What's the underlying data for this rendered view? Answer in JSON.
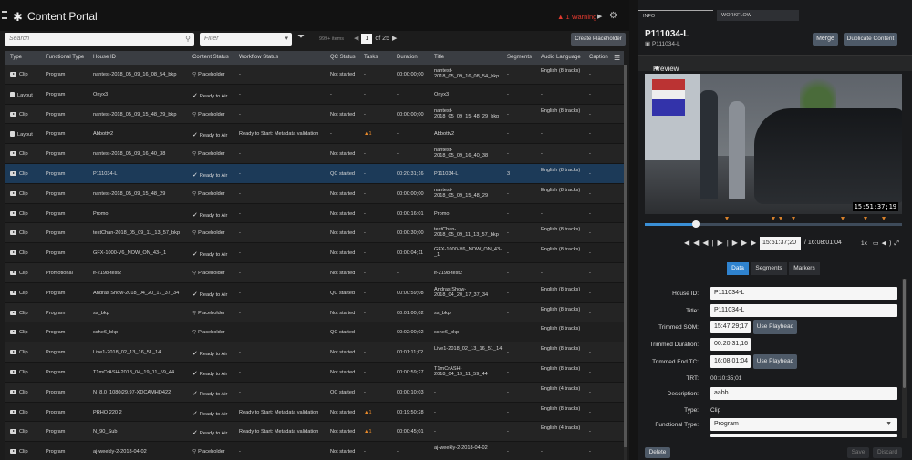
{
  "app": {
    "title": "Content Portal",
    "warning_label": "1 Warning",
    "logo": "portal-logo-icon"
  },
  "toolbar": {
    "search_placeholder": "Search",
    "filter_placeholder": "Filter",
    "item_count": "999+ items",
    "page_current": "1",
    "page_total": "of 25",
    "create_label": "Create Placeholder"
  },
  "table": {
    "headers": [
      "Type",
      "Functional Type",
      "House ID",
      "Content Status",
      "Workflow Status",
      "QC Status",
      "Tasks",
      "Duration",
      "Title",
      "Segments",
      "Audio Language",
      "Caption"
    ],
    "selected_index": 5,
    "rows": [
      {
        "type": "Clip",
        "ftype": "Program",
        "house_id": "nantest-2018_05_09_16_08_54_bkp",
        "status": "Placeholder",
        "wf": "-",
        "qc": "Not started",
        "tasks": "-",
        "duration": "00:00:00;00",
        "title": "nantest-2018_05_09_16_08_54_bkp",
        "segments": "-",
        "audio": "English (8 tracks)",
        "caption": "-"
      },
      {
        "type": "Layout",
        "ftype": "Program",
        "house_id": "Onyx3",
        "status": "Ready to Air",
        "wf": "-",
        "qc": "-",
        "tasks": "-",
        "duration": "-",
        "title": "Onyx3",
        "segments": "-",
        "audio": "-",
        "caption": "-"
      },
      {
        "type": "Clip",
        "ftype": "Program",
        "house_id": "nantest-2018_05_09_15_48_29_bkp",
        "status": "Placeholder",
        "wf": "-",
        "qc": "Not started",
        "tasks": "-",
        "duration": "00:00:00;00",
        "title": "nantest-2018_05_09_15_48_29_bkp",
        "segments": "-",
        "audio": "English (8 tracks)",
        "caption": "-"
      },
      {
        "type": "Layout",
        "ftype": "Program",
        "house_id": "Abbottv2",
        "status": "Ready to Air",
        "wf": "Ready to Start: Metadata validation",
        "qc": "-",
        "tasks": "1",
        "duration": "-",
        "title": "Abbottv2",
        "segments": "-",
        "audio": "-",
        "caption": "-"
      },
      {
        "type": "Clip",
        "ftype": "Program",
        "house_id": "nantest-2018_05_09_16_40_38",
        "status": "Placeholder",
        "wf": "-",
        "qc": "Not started",
        "tasks": "-",
        "duration": "-",
        "title": "nantest-2018_05_09_16_40_38",
        "segments": "-",
        "audio": "-",
        "caption": "-"
      },
      {
        "type": "Clip",
        "ftype": "Program",
        "house_id": "P111034-L",
        "status": "Ready to Air",
        "wf": "-",
        "qc": "QC started",
        "tasks": "-",
        "duration": "00:20:31;16",
        "title": "P111034-L",
        "segments": "3",
        "audio": "English (8 tracks)",
        "caption": "-"
      },
      {
        "type": "Clip",
        "ftype": "Program",
        "house_id": "nantest-2018_05_09_15_48_29",
        "status": "Placeholder",
        "wf": "-",
        "qc": "Not started",
        "tasks": "-",
        "duration": "00:00:00;00",
        "title": "nantest-2018_05_09_15_48_29",
        "segments": "-",
        "audio": "English (8 tracks)",
        "caption": "-"
      },
      {
        "type": "Clip",
        "ftype": "Program",
        "house_id": "Promo",
        "status": "Ready to Air",
        "wf": "-",
        "qc": "Not started",
        "tasks": "-",
        "duration": "00:00:16:01",
        "title": "Promo",
        "segments": "-",
        "audio": "-",
        "caption": "-"
      },
      {
        "type": "Clip",
        "ftype": "Program",
        "house_id": "testChan-2018_05_09_11_13_57_bkp",
        "status": "Placeholder",
        "wf": "-",
        "qc": "Not started",
        "tasks": "-",
        "duration": "00:00:30;00",
        "title": "testChan-2018_05_09_11_13_57_bkp",
        "segments": "-",
        "audio": "English (8 tracks)",
        "caption": "-"
      },
      {
        "type": "Clip",
        "ftype": "Program",
        "house_id": "GFX-1000-V6_NOW_ON_43-_1",
        "status": "Ready to Air",
        "wf": "-",
        "qc": "Not started",
        "tasks": "-",
        "duration": "00:00:04;11",
        "title": "GFX-1000-V6_NOW_ON_43-_1",
        "segments": "-",
        "audio": "English (8 tracks)",
        "caption": "-"
      },
      {
        "type": "Clip",
        "ftype": "Promotional",
        "house_id": "lf-2198-test2",
        "status": "Placeholder",
        "wf": "-",
        "qc": "Not started",
        "tasks": "-",
        "duration": "-",
        "title": "lf-2198-test2",
        "segments": "-",
        "audio": "-",
        "caption": "-"
      },
      {
        "type": "Clip",
        "ftype": "Program",
        "house_id": "Andras Show-2018_04_20_17_37_34",
        "status": "Ready to Air",
        "wf": "-",
        "qc": "QC started",
        "tasks": "-",
        "duration": "00:00:59;08",
        "title": "Andras Show-2018_04_20_17_37_34",
        "segments": "-",
        "audio": "English (8 tracks)",
        "caption": "-"
      },
      {
        "type": "Clip",
        "ftype": "Program",
        "house_id": "ss_bkp",
        "status": "Placeholder",
        "wf": "-",
        "qc": "Not started",
        "tasks": "-",
        "duration": "00:01:00;02",
        "title": "ss_bkp",
        "segments": "-",
        "audio": "English (8 tracks)",
        "caption": "-"
      },
      {
        "type": "Clip",
        "ftype": "Program",
        "house_id": "sche6_bkp",
        "status": "Placeholder",
        "wf": "-",
        "qc": "QC started",
        "tasks": "-",
        "duration": "00:02:00;02",
        "title": "sche6_bkp",
        "segments": "-",
        "audio": "English (8 tracks)",
        "caption": "-"
      },
      {
        "type": "Clip",
        "ftype": "Program",
        "house_id": "Live1-2018_02_13_16_51_14",
        "status": "Ready to Air",
        "wf": "-",
        "qc": "Not started",
        "tasks": "-",
        "duration": "00:01:11;02",
        "title": "Live1-2018_02_13_16_51_14",
        "segments": "-",
        "audio": "English (8 tracks)",
        "caption": "-"
      },
      {
        "type": "Clip",
        "ftype": "Program",
        "house_id": "T1mCrASH-2018_04_19_11_59_44",
        "status": "Ready to Air",
        "wf": "-",
        "qc": "Not started",
        "tasks": "-",
        "duration": "00:00:59;27",
        "title": "T1mCrASH-2018_04_19_11_59_44",
        "segments": "-",
        "audio": "English (8 tracks)",
        "caption": "-"
      },
      {
        "type": "Clip",
        "ftype": "Program",
        "house_id": "N_8.0_1080i29.97-XDCAMHD422",
        "status": "Ready to Air",
        "wf": "-",
        "qc": "QC started",
        "tasks": "-",
        "duration": "00:00:10;03",
        "title": "-",
        "segments": "-",
        "audio": "English (4 tracks)",
        "caption": "-"
      },
      {
        "type": "Clip",
        "ftype": "Program",
        "house_id": "PRHQ 220 2",
        "status": "Ready to Air",
        "wf": "Ready to Start: Metadata validation",
        "qc": "Not started",
        "tasks": "1",
        "duration": "00:19:50;28",
        "title": "-",
        "segments": "-",
        "audio": "English (8 tracks)",
        "caption": "-"
      },
      {
        "type": "Clip",
        "ftype": "Program",
        "house_id": "N_90_Sub",
        "status": "Ready to Air",
        "wf": "Ready to Start: Metadata validation",
        "qc": "Not started",
        "tasks": "1",
        "duration": "00:00:45;01",
        "title": "-",
        "segments": "-",
        "audio": "English (4 tracks)",
        "caption": "-"
      },
      {
        "type": "Clip",
        "ftype": "Program",
        "house_id": "aj-weekly-2-2018-04-02",
        "status": "Placeholder",
        "wf": "-",
        "qc": "Not started",
        "tasks": "-",
        "duration": "-",
        "title": "aj-weekly-2-2018-04-02",
        "segments": "-",
        "audio": "-",
        "caption": "-"
      }
    ]
  },
  "right": {
    "tabs": [
      "INFO",
      "WORKFLOW"
    ],
    "asset_title": "P111034-L",
    "asset_sub": "P111034-L",
    "merge_label": "Merge",
    "duplicate_label": "Duplicate Content",
    "preview_label": "Preview",
    "timecode_overlay": "15:51:37;19",
    "progress": 0.2,
    "markers": [
      0.32,
      0.5,
      0.53,
      0.58,
      0.77,
      0.86,
      0.93
    ],
    "current_tc": "15:51:37;20",
    "duration_tc": "/ 16:08:01;04",
    "speed": "1x",
    "subtabs": [
      "Data",
      "Segments",
      "Markers"
    ],
    "form": {
      "house_id_label": "House ID:",
      "house_id": "P111034-L",
      "title_label": "Title:",
      "title": "P111034-L",
      "som_label": "Trimmed SOM:",
      "som": "15:47:29;17",
      "tdur_label": "Trimmed Duration:",
      "tdur": "00:20:31;16",
      "endtc_label": "Trimmed End TC:",
      "endtc": "16:08:01;04",
      "use_playhead": "Use Playhead",
      "trt_label": "TRT:",
      "trt": "00:10:35;01",
      "desc_label": "Description:",
      "desc": "aabb",
      "type_label": "Type:",
      "type": "Clip",
      "ftype_label": "Functional Type:",
      "ftype": "Program"
    },
    "delete_label": "Delete",
    "save_label": "Save",
    "discard_label": "Discard"
  },
  "colors": {
    "accent": "#2f83cf",
    "warning": "#e03a2f",
    "selected_row": "#1c3a58",
    "task_warn": "#e98a2a"
  }
}
